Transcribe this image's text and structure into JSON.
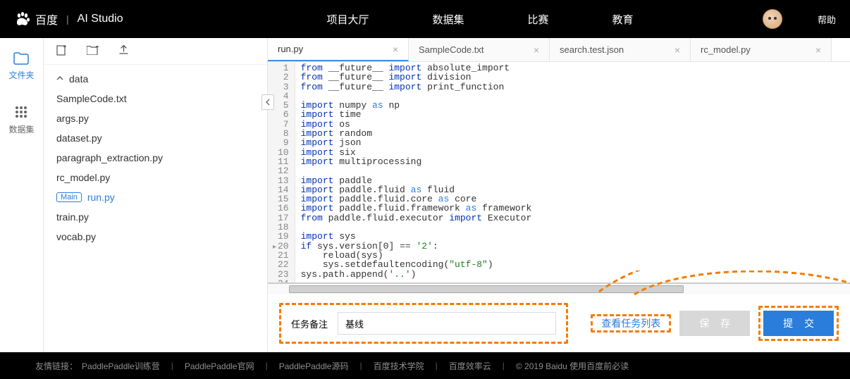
{
  "nav": {
    "brand_cn": "百度",
    "brand_studio": "AI Studio",
    "links": [
      "项目大厅",
      "数据集",
      "比赛",
      "教育"
    ],
    "help": "帮助"
  },
  "rail": {
    "files": "文件夹",
    "datasets": "数据集"
  },
  "file_panel": {
    "root": "data",
    "files": [
      "SampleCode.txt",
      "args.py",
      "dataset.py",
      "paragraph_extraction.py",
      "rc_model.py"
    ],
    "main_badge": "Main",
    "main_file": "run.py",
    "rest": [
      "train.py",
      "vocab.py"
    ]
  },
  "tabs": [
    {
      "name": "run.py",
      "active": true
    },
    {
      "name": "SampleCode.txt",
      "active": false
    },
    {
      "name": "search.test.json",
      "active": false
    },
    {
      "name": "rc_model.py",
      "active": false
    }
  ],
  "code": {
    "lines": [
      [
        [
          "kw-blue",
          "from"
        ],
        [
          "",
          " __future__ "
        ],
        [
          "kw-import",
          "import"
        ],
        [
          "",
          " absolute_import"
        ]
      ],
      [
        [
          "kw-blue",
          "from"
        ],
        [
          "",
          " __future__ "
        ],
        [
          "kw-import",
          "import"
        ],
        [
          "",
          " division"
        ]
      ],
      [
        [
          "kw-blue",
          "from"
        ],
        [
          "",
          " __future__ "
        ],
        [
          "kw-import",
          "import"
        ],
        [
          "",
          " print_function"
        ]
      ],
      [
        [
          "",
          ""
        ]
      ],
      [
        [
          "kw-import",
          "import"
        ],
        [
          "",
          " numpy "
        ],
        [
          "kw-as",
          "as"
        ],
        [
          "",
          " np"
        ]
      ],
      [
        [
          "kw-import",
          "import"
        ],
        [
          "",
          " time"
        ]
      ],
      [
        [
          "kw-import",
          "import"
        ],
        [
          "",
          " os"
        ]
      ],
      [
        [
          "kw-import",
          "import"
        ],
        [
          "",
          " random"
        ]
      ],
      [
        [
          "kw-import",
          "import"
        ],
        [
          "",
          " json"
        ]
      ],
      [
        [
          "kw-import",
          "import"
        ],
        [
          "",
          " six"
        ]
      ],
      [
        [
          "kw-import",
          "import"
        ],
        [
          "",
          " multiprocessing"
        ]
      ],
      [
        [
          "",
          ""
        ]
      ],
      [
        [
          "kw-import",
          "import"
        ],
        [
          "",
          " paddle"
        ]
      ],
      [
        [
          "kw-import",
          "import"
        ],
        [
          "",
          " paddle.fluid "
        ],
        [
          "kw-as",
          "as"
        ],
        [
          "",
          " fluid"
        ]
      ],
      [
        [
          "kw-import",
          "import"
        ],
        [
          "",
          " paddle.fluid.core "
        ],
        [
          "kw-as",
          "as"
        ],
        [
          "",
          " core"
        ]
      ],
      [
        [
          "kw-import",
          "import"
        ],
        [
          "",
          " paddle.fluid.framework "
        ],
        [
          "kw-as",
          "as"
        ],
        [
          "",
          " framework"
        ]
      ],
      [
        [
          "kw-blue",
          "from"
        ],
        [
          "",
          " paddle.fluid.executor "
        ],
        [
          "kw-import",
          "import"
        ],
        [
          "",
          " Executor"
        ]
      ],
      [
        [
          "",
          ""
        ]
      ],
      [
        [
          "kw-import",
          "import"
        ],
        [
          "",
          " sys"
        ]
      ],
      [
        [
          "kw-blue",
          "if"
        ],
        [
          "",
          " sys.version["
        ],
        [
          "",
          "0"
        ],
        [
          "",
          "] "
        ],
        [
          "op",
          "=="
        ],
        [
          "",
          " "
        ],
        [
          "kw-str",
          "'2'"
        ],
        [
          "",
          ":"
        ]
      ],
      [
        [
          "",
          "    reload(sys)"
        ]
      ],
      [
        [
          "",
          "    sys.setdefaultencoding("
        ],
        [
          "kw-str",
          "\"utf-8\""
        ],
        [
          "",
          ")"
        ]
      ],
      [
        [
          "",
          "sys.path.append("
        ],
        [
          "kw-str",
          "'..'"
        ],
        [
          "",
          ")"
        ]
      ],
      [
        [
          "",
          ""
        ]
      ]
    ],
    "fold_line": 20
  },
  "bottom": {
    "label": "任务备注",
    "input_value": "基线",
    "view_tasks": "查看任务列表",
    "save": "保 存",
    "submit": "提 交"
  },
  "footer": {
    "prefix": "友情链接：",
    "links": [
      "PaddlePaddle训练营",
      "PaddlePaddle官网",
      "PaddlePaddle源码",
      "百度技术学院",
      "百度效率云"
    ],
    "copyright": "© 2019 Baidu 使用百度前必读"
  }
}
